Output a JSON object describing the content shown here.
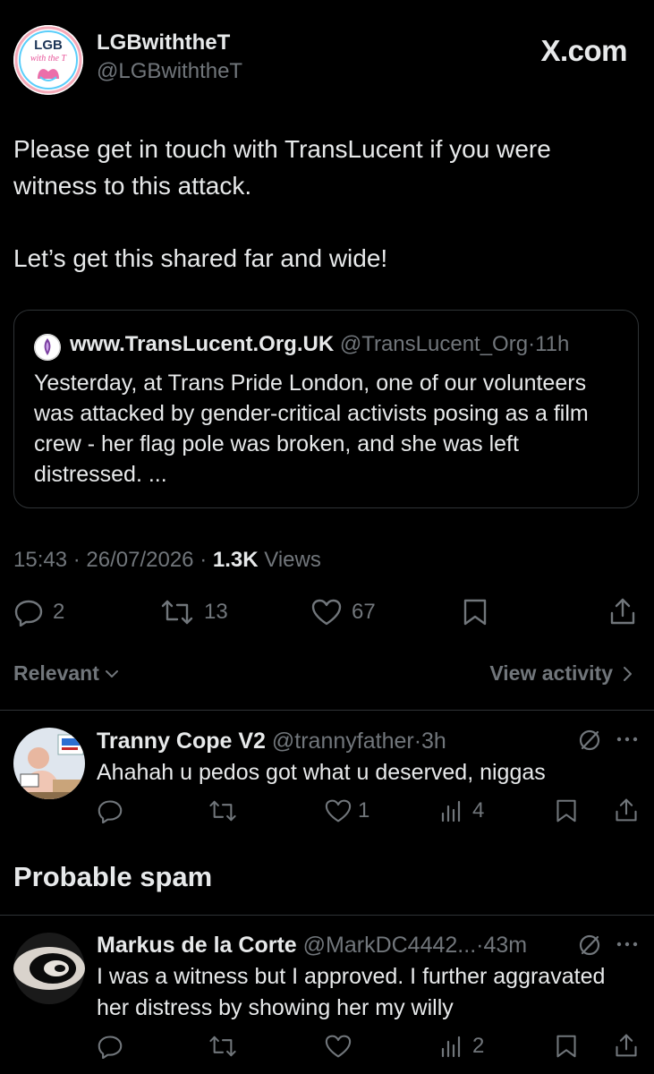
{
  "brand": {
    "label": "X.com"
  },
  "post": {
    "author_name": "LGBwiththeT",
    "author_handle": "@LGBwiththeT",
    "avatar_text_top": "LGB",
    "avatar_text_bottom": "with the T",
    "paragraph1": "Please get in touch with TransLucent if you were witness to this attack.",
    "paragraph2": "Let’s get this shared far and wide!",
    "time": "15:43",
    "date": "26/07/2026",
    "views_count": "1.3K",
    "views_label": "Views",
    "dot": "·",
    "actions": {
      "replies": "2",
      "reposts": "13",
      "likes": "67"
    }
  },
  "quote": {
    "author_name": "www.TransLucent.Org.UK",
    "author_handle": "@TransLucent_Org",
    "time": "11h",
    "text": "Yesterday, at Trans Pride London, one of our volunteers was attacked by gender-critical activists posing as a film crew - her flag pole was broken, and she was left distressed. ..."
  },
  "filter": {
    "sort_label": "Relevant",
    "view_activity_label": "View activity"
  },
  "replies": [
    {
      "author_name": "Tranny Cope V2",
      "author_handle": "@trannyfather",
      "time": "3h",
      "text": "Ahahah u pedos got what u deserved, niggas",
      "likes": "1",
      "views": "4"
    }
  ],
  "spam_section": {
    "heading": "Probable spam"
  },
  "spam_replies": [
    {
      "author_name": "Markus de la Corte",
      "author_handle": "@MarkDC4442...",
      "time": "43m",
      "text": "I was a witness but I approved. I further aggravated her distress by showing her my willy",
      "views": "2"
    }
  ],
  "icons": {
    "reply": "speech-bubble-icon",
    "repost": "repost-arrows-icon",
    "like": "heart-icon",
    "bookmark": "bookmark-icon",
    "share": "share-upload-icon",
    "views": "bar-chart-icon",
    "grok": "grok-slash-circle-icon",
    "more": "more-dots-icon"
  },
  "colors": {
    "background": "#000000",
    "text": "#e7e9ea",
    "muted": "#71767b",
    "border": "#2f3336"
  }
}
